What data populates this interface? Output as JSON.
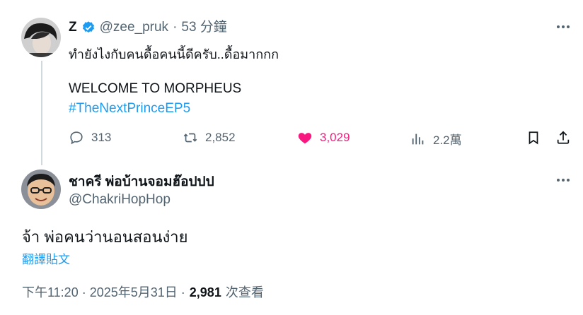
{
  "parent_tweet": {
    "display_name": "Z",
    "handle": "@zee_pruk",
    "separator": "·",
    "time_ago": "53 分鐘",
    "text_line1": "ทำยังไงกับคนดื้อคนนี้ดีครับ..ดื้อมากกก",
    "text_line2": "WELCOME TO MORPHEUS",
    "hashtag": "#TheNextPrinceEP5",
    "actions": {
      "replies": "313",
      "reposts": "2,852",
      "likes": "3,029",
      "views": "2.2萬"
    }
  },
  "reply_tweet": {
    "display_name": "ชาครี พ่อบ้านจอมฮ๊อปปป",
    "handle": "@ChakriHopHop",
    "text": "จ้า พ่อคนว่านอนสอนง่าย",
    "translate_label": "翻譯貼文",
    "timestamp": "下午11:20 · 2025年5月31日 ·",
    "view_count": "2,981",
    "view_label": "次查看"
  },
  "colors": {
    "like": "#f91880",
    "verified": "#1d9bf0",
    "link": "#1d9bf0",
    "muted": "#536471"
  },
  "icons": [
    "verified-badge-icon",
    "reply-icon",
    "repost-icon",
    "like-icon",
    "views-icon",
    "bookmark-icon",
    "share-icon",
    "more-icon"
  ]
}
